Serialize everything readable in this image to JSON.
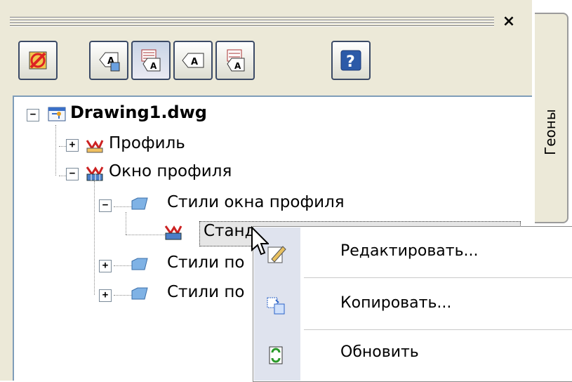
{
  "side_tab": {
    "label": "Геоны"
  },
  "tree": {
    "root": {
      "label": "Drawing1.dwg",
      "expander": "−"
    },
    "n_profile": {
      "label": "Профиль",
      "expander": "+"
    },
    "n_window": {
      "label": "Окно профиля",
      "expander": "−"
    },
    "n_styles_window": {
      "label": "Стили окна профиля",
      "expander": "−"
    },
    "n_standard": {
      "label": "Станд"
    },
    "n_styles_2": {
      "label": "Стили по",
      "expander": "+"
    },
    "n_styles_3": {
      "label": "Стили по",
      "expander": "+"
    }
  },
  "menu": {
    "edit": "Редактировать...",
    "copy": "Копировать...",
    "refresh": "Обновить"
  },
  "colors": {
    "accent": "#3b4a66",
    "tree_border": "#7f9db9",
    "folder": "#7fb2e5",
    "profile_icon": "#cc2222"
  }
}
